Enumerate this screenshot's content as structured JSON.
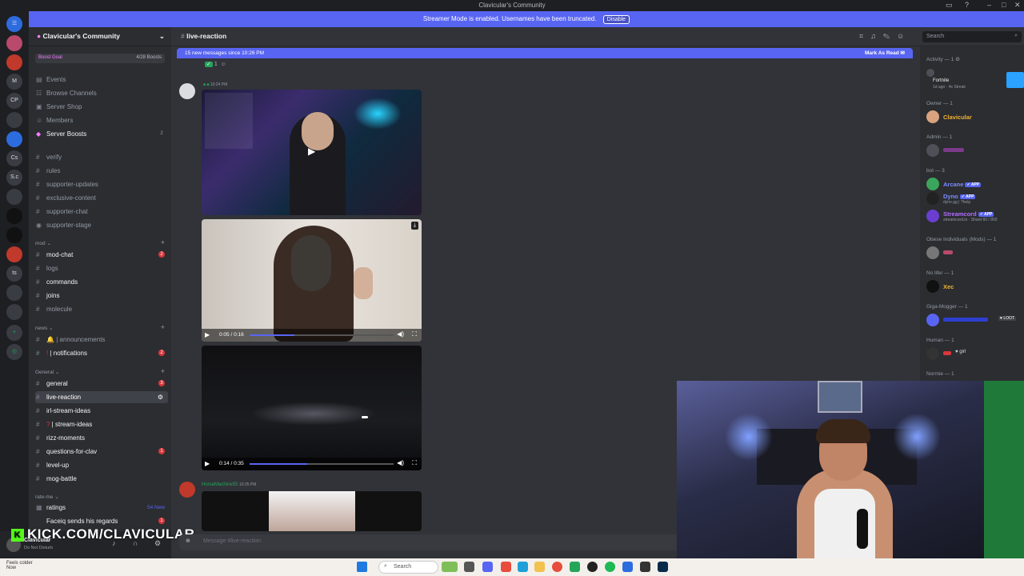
{
  "window": {
    "title": "Clavicular's Community"
  },
  "banner": {
    "text": "Streamer Mode is enabled. Usernames have been truncated.",
    "button": "Disable"
  },
  "server": {
    "name": "Clavicular's Community",
    "boost_goal": "Boost Goal",
    "boosts": "4/28 Boosts"
  },
  "nav": [
    "Events",
    "Browse Channels",
    "Server Shop",
    "Members",
    "Server Boosts"
  ],
  "nav_badge": "2",
  "channels_top": [
    "verify",
    "rules",
    "supporter-updates",
    "exclusive-content",
    "supporter-chat",
    "supporter-stage"
  ],
  "categories": {
    "mod": "mod",
    "news": "news",
    "general": "General",
    "rate": "rate-me"
  },
  "mod_channels": [
    {
      "name": "mod-chat",
      "badge": "2"
    },
    {
      "name": "logs"
    },
    {
      "name": "commands"
    },
    {
      "name": "joins"
    },
    {
      "name": "molecule"
    }
  ],
  "news_channels": [
    {
      "name": "| announcements"
    },
    {
      "name": "| notifications",
      "badge": "2"
    }
  ],
  "general_channels": [
    {
      "name": "general",
      "badge": "3"
    },
    {
      "name": "live-reaction"
    },
    {
      "name": "irl-stream-ideas"
    },
    {
      "name": "| stream-ideas"
    },
    {
      "name": "rizz-moments"
    },
    {
      "name": "questions-for-clav",
      "badge": "1"
    },
    {
      "name": "level-up"
    },
    {
      "name": "mog-battle"
    }
  ],
  "rate_channels": [
    {
      "name": "ratings",
      "new": "54 New"
    },
    {
      "name": "Faceiq sends his regards",
      "badge": "1"
    }
  ],
  "user": {
    "name": "Clavicular",
    "status": "Do Not Disturb"
  },
  "overlay": {
    "kick": "KICK.COM/CLAVICULAR"
  },
  "channel": {
    "name": "live-reaction"
  },
  "search": {
    "placeholder": "Search"
  },
  "new_messages": {
    "text": "15 new messages since 10:26 PM",
    "action": "Mark As Read"
  },
  "messages": [
    {
      "time": "10:24 PM"
    },
    {
      "author": "HorseMachine55",
      "time": "10:25 PM"
    }
  ],
  "videos": [
    {
      "time": "0:05 / 0:16",
      "progress": 0.31
    },
    {
      "time": "0:14 / 0:35",
      "progress": 0.4
    }
  ],
  "composer": {
    "placeholder": "Message #live-reaction"
  },
  "members": {
    "activity": "Activity — 1",
    "activity_game": "Fortnite",
    "activity_sub": "1d ago · 4x Streak",
    "owner_head": "Owner — 1",
    "owner": "Clavicular",
    "admin_head": "Admin — 1",
    "bot_head": "bot — 3",
    "bots": [
      {
        "name": "Arcane",
        "sub": ""
      },
      {
        "name": "Dyno",
        "sub": "dyno.gg | ?help"
      },
      {
        "name": "Streamcord",
        "sub": "streamcord.io · Shard 60 / 800"
      }
    ],
    "app_tag": "APP",
    "obese_head": "Obese Individuals (Mods) — 1",
    "nolifer_head": "No lifer — 1",
    "nolifer": "Xec",
    "giga_head": "Giga-Mogger — 1",
    "giga_tag": "LOOT",
    "human_head": "Human — 1",
    "human_tag": "girl",
    "normie_head": "Normie — 1"
  },
  "taskbar": {
    "weather": "Feels colder",
    "weather_sub": "Now",
    "search": "Search"
  },
  "colors": {
    "blurple": "#5865f2",
    "owner": "#f0b232",
    "bot": "#7c8cff",
    "kick": "#53fc18"
  }
}
